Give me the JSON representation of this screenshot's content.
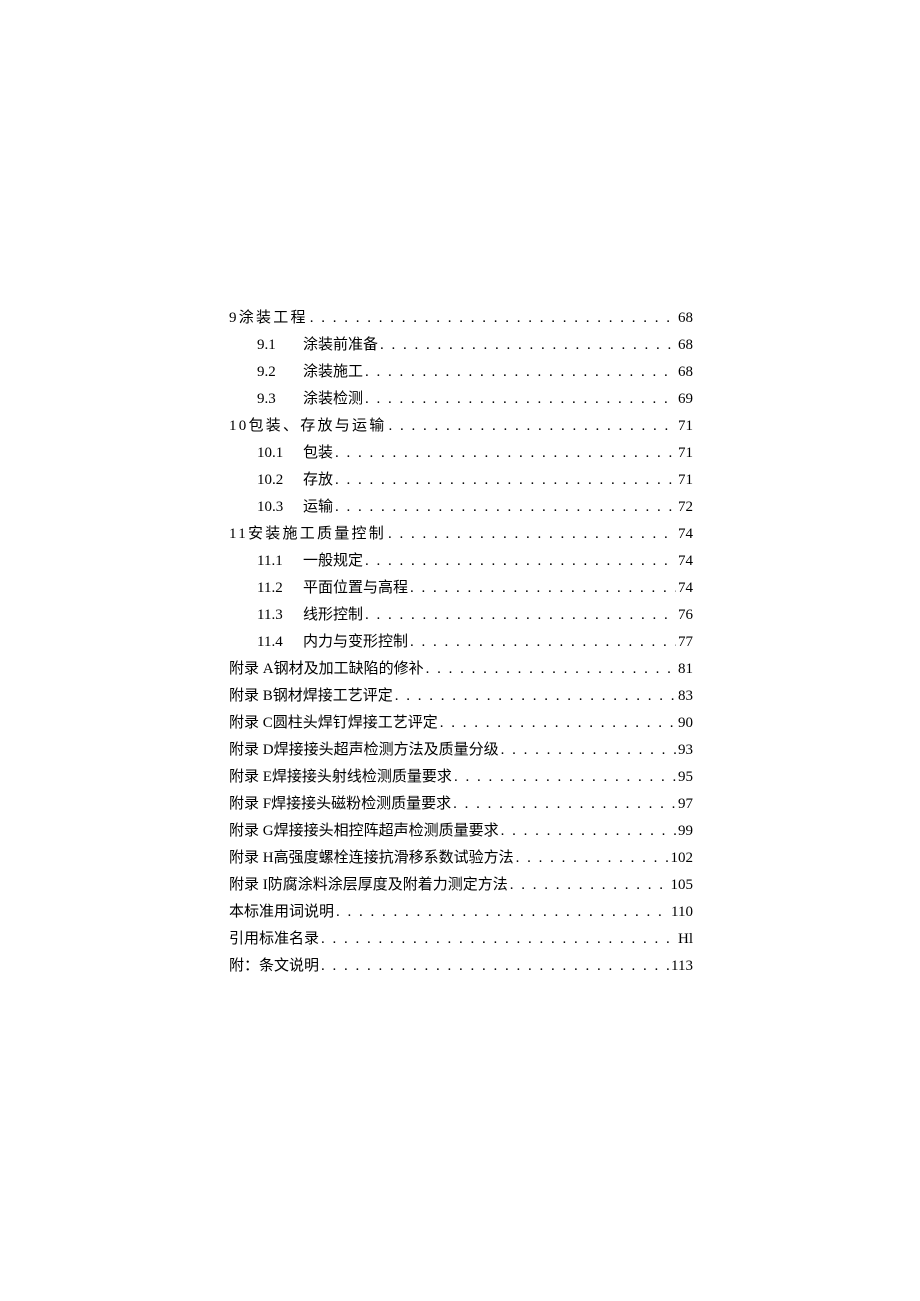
{
  "toc": [
    {
      "type": "main",
      "num": "9",
      "title": "涂装工程",
      "page": "68",
      "spacing": true
    },
    {
      "type": "sub",
      "num": "9.1",
      "title": "涂装前准备",
      "page": "68"
    },
    {
      "type": "sub",
      "num": "9.2",
      "title": "涂装施工",
      "page": "68"
    },
    {
      "type": "sub",
      "num": "9.3",
      "title": "涂装检测",
      "page": "69"
    },
    {
      "type": "main",
      "num": "10",
      "title": "包装、存放与运输",
      "page": "71",
      "spacing": true
    },
    {
      "type": "sub",
      "num": "10.1",
      "title": "包装",
      "page": "71"
    },
    {
      "type": "sub",
      "num": "10.2",
      "title": "存放",
      "page": "71"
    },
    {
      "type": "sub",
      "num": "10.3",
      "title": "运输",
      "page": "72"
    },
    {
      "type": "main",
      "num": "11",
      "title": "安装施工质量控制",
      "page": "74",
      "spacing": true
    },
    {
      "type": "sub",
      "num": "11.1",
      "title": "一般规定",
      "page": "74"
    },
    {
      "type": "sub",
      "num": "11.2",
      "title": "平面位置与高程",
      "page": "74"
    },
    {
      "type": "sub",
      "num": "11.3",
      "title": "线形控制",
      "page": "76"
    },
    {
      "type": "sub",
      "num": "11.4",
      "title": "内力与变形控制",
      "page": "77"
    },
    {
      "type": "main",
      "num": "附录 A",
      "title": "钢材及加工缺陷的修补",
      "page": "81"
    },
    {
      "type": "main",
      "num": "附录 B",
      "title": "钢材焊接工艺评定",
      "page": "83"
    },
    {
      "type": "main",
      "num": "附录 C",
      "title": "圆柱头焊钉焊接工艺评定",
      "page": "90"
    },
    {
      "type": "main",
      "num": "附录 D",
      "title": "焊接接头超声检测方法及质量分级",
      "page": "93"
    },
    {
      "type": "main",
      "num": "附录 E",
      "title": "焊接接头射线检测质量要求",
      "page": "95"
    },
    {
      "type": "main",
      "num": "附录 F",
      "title": "焊接接头磁粉检测质量要求",
      "page": "97"
    },
    {
      "type": "main",
      "num": "附录 G",
      "title": "焊接接头相控阵超声检测质量要求",
      "page": "99"
    },
    {
      "type": "main",
      "num": "附录 H",
      "title": "高强度螺栓连接抗滑移系数试验方法",
      "page": "102"
    },
    {
      "type": "main",
      "num": "附录 I",
      "title": "防腐涂料涂层厚度及附着力测定方法",
      "page": "105"
    },
    {
      "type": "main",
      "num": "",
      "title": "本标准用词说明",
      "page": "110"
    },
    {
      "type": "main",
      "num": "",
      "title": "引用标准名录",
      "page": "Hl"
    },
    {
      "type": "main",
      "num": "",
      "title": "附：条文说明",
      "page": "113"
    }
  ]
}
